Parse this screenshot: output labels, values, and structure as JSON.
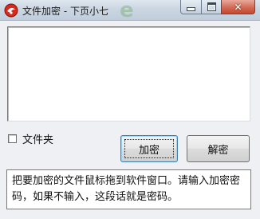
{
  "window": {
    "title": "文件加密 - 下页小七",
    "watermark": "e",
    "icon": "app-icon",
    "close_glyph": "✕"
  },
  "options": {
    "folder_checkbox_label": "文件夹",
    "folder_checked": false
  },
  "buttons": {
    "encrypt_label": "加密",
    "decrypt_label": "解密"
  },
  "status": {
    "message": "把要加密的文件鼠标拖到软件窗口。请输入加密密码，如果不输入，这段话就是密码。"
  },
  "colors": {
    "close_button": "#c4482f",
    "focus_border": "#3c7fb1"
  }
}
